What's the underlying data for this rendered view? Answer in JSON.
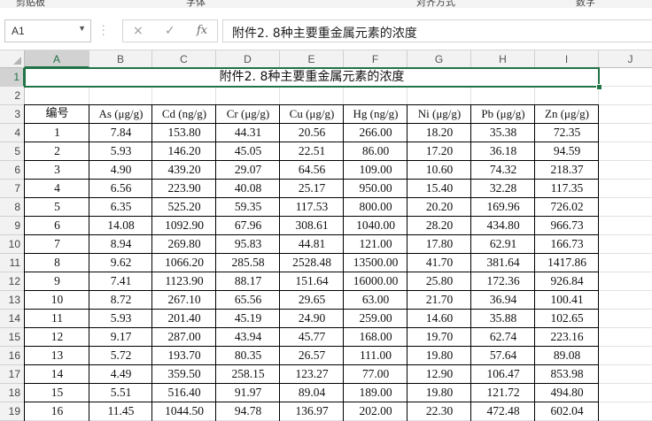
{
  "ribbon": {
    "groups": [
      "剪贴板",
      "字体",
      "对齐方式",
      "数字"
    ]
  },
  "formula_bar": {
    "name_box": "A1",
    "formula": "附件2. 8种主要重金属元素的浓度",
    "cancel_icon": "×",
    "enter_icon": "✓",
    "fx_label": "fx"
  },
  "sheet": {
    "column_letters": [
      "A",
      "B",
      "C",
      "D",
      "E",
      "F",
      "G",
      "H",
      "I",
      "J"
    ],
    "row_numbers": [
      "1",
      "2",
      "3",
      "4",
      "5",
      "6",
      "7",
      "8",
      "9",
      "10",
      "11",
      "12",
      "13",
      "14",
      "15",
      "16",
      "17",
      "18",
      "19"
    ],
    "title": "附件2. 8种主要重金属元素的浓度",
    "headers": [
      "编号",
      "As (μg/g)",
      "Cd (ng/g)",
      "Cr (μg/g)",
      "Cu (μg/g)",
      "Hg (ng/g)",
      "Ni (μg/g)",
      "Pb (μg/g)",
      "Zn (μg/g)"
    ],
    "rows": [
      [
        "1",
        "7.84",
        "153.80",
        "44.31",
        "20.56",
        "266.00",
        "18.20",
        "35.38",
        "72.35"
      ],
      [
        "2",
        "5.93",
        "146.20",
        "45.05",
        "22.51",
        "86.00",
        "17.20",
        "36.18",
        "94.59"
      ],
      [
        "3",
        "4.90",
        "439.20",
        "29.07",
        "64.56",
        "109.00",
        "10.60",
        "74.32",
        "218.37"
      ],
      [
        "4",
        "6.56",
        "223.90",
        "40.08",
        "25.17",
        "950.00",
        "15.40",
        "32.28",
        "117.35"
      ],
      [
        "5",
        "6.35",
        "525.20",
        "59.35",
        "117.53",
        "800.00",
        "20.20",
        "169.96",
        "726.02"
      ],
      [
        "6",
        "14.08",
        "1092.90",
        "67.96",
        "308.61",
        "1040.00",
        "28.20",
        "434.80",
        "966.73"
      ],
      [
        "7",
        "8.94",
        "269.80",
        "95.83",
        "44.81",
        "121.00",
        "17.80",
        "62.91",
        "166.73"
      ],
      [
        "8",
        "9.62",
        "1066.20",
        "285.58",
        "2528.48",
        "13500.00",
        "41.70",
        "381.64",
        "1417.86"
      ],
      [
        "9",
        "7.41",
        "1123.90",
        "88.17",
        "151.64",
        "16000.00",
        "25.80",
        "172.36",
        "926.84"
      ],
      [
        "10",
        "8.72",
        "267.10",
        "65.56",
        "29.65",
        "63.00",
        "21.70",
        "36.94",
        "100.41"
      ],
      [
        "11",
        "5.93",
        "201.40",
        "45.19",
        "24.90",
        "259.00",
        "14.60",
        "35.88",
        "102.65"
      ],
      [
        "12",
        "9.17",
        "287.00",
        "43.94",
        "45.77",
        "168.00",
        "19.70",
        "62.74",
        "223.16"
      ],
      [
        "13",
        "5.72",
        "193.70",
        "80.35",
        "26.57",
        "111.00",
        "19.80",
        "57.64",
        "89.08"
      ],
      [
        "14",
        "4.49",
        "359.50",
        "258.15",
        "123.27",
        "77.00",
        "12.90",
        "106.47",
        "853.98"
      ],
      [
        "15",
        "5.51",
        "516.40",
        "91.97",
        "89.04",
        "189.00",
        "19.80",
        "121.72",
        "494.80"
      ],
      [
        "16",
        "11.45",
        "1044.50",
        "94.78",
        "136.97",
        "202.00",
        "22.30",
        "472.48",
        "602.04"
      ]
    ]
  }
}
